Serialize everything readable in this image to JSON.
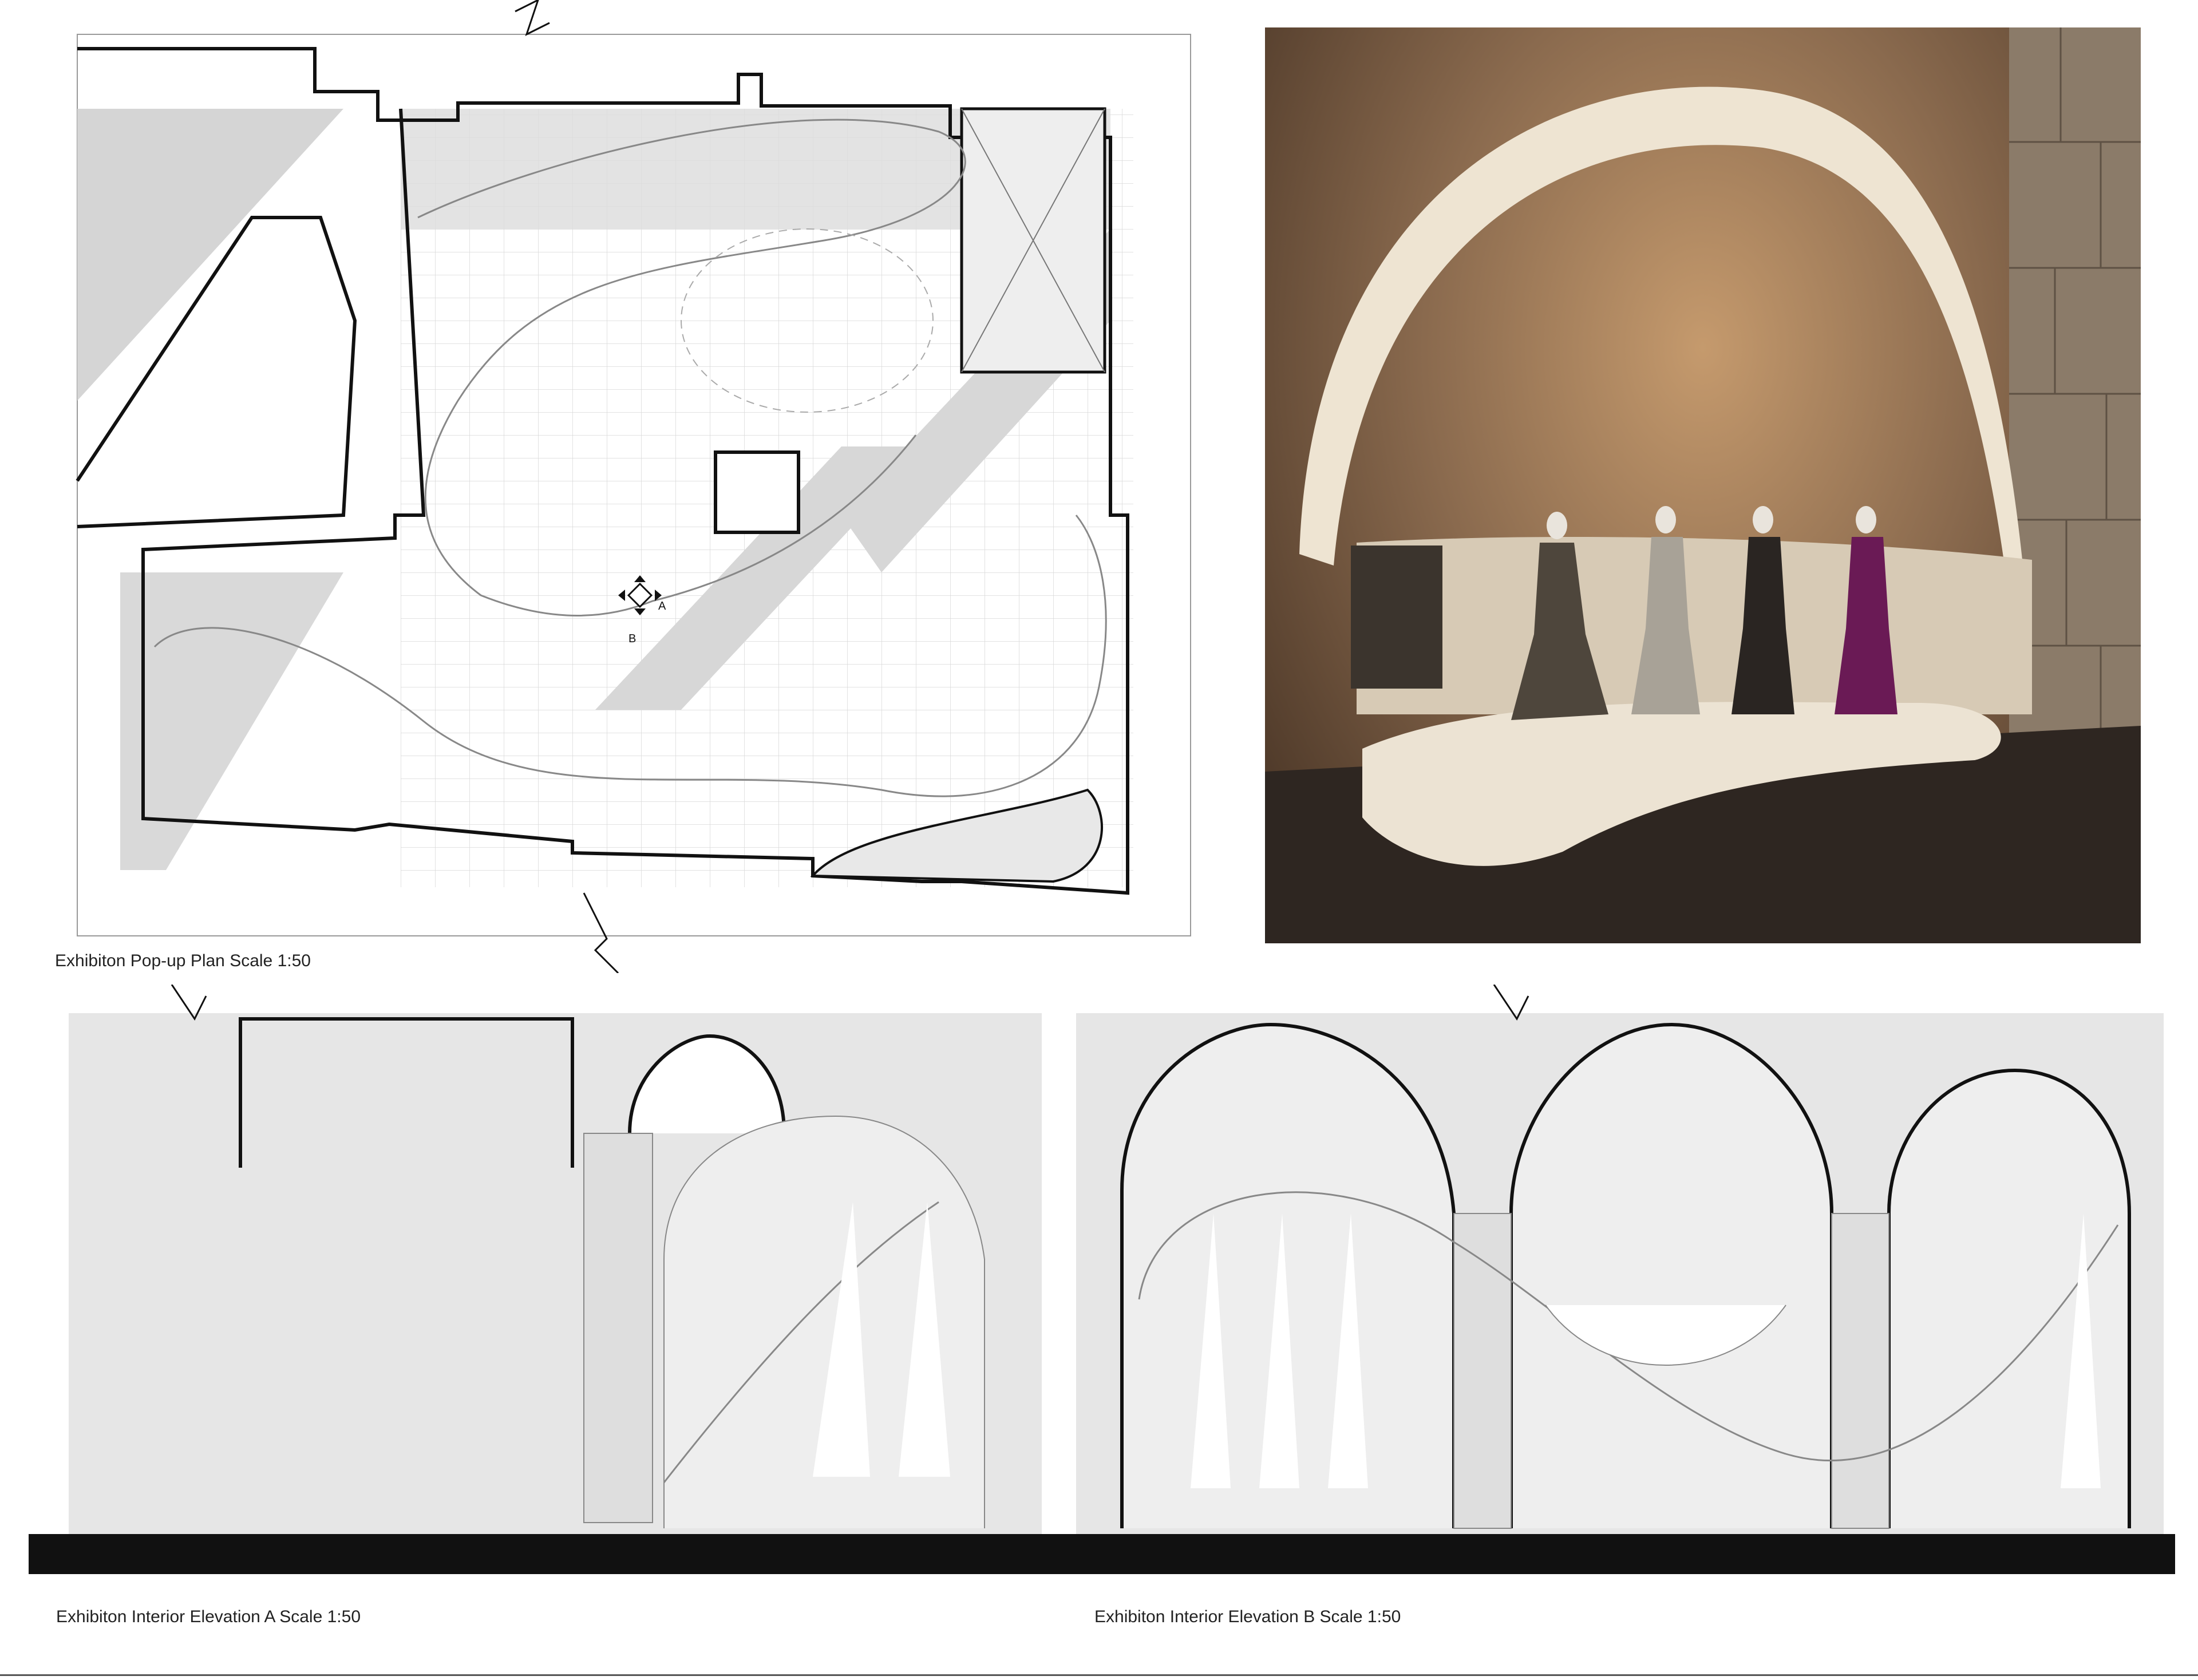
{
  "captions": {
    "plan": "Exhibiton Pop-up Plan Scale 1:50",
    "elevation_a": "Exhibiton Interior Elevation A Scale 1:50",
    "elevation_b": "Exhibiton Interior Elevation B Scale 1:50"
  },
  "plan_markers": {
    "section_a": "A",
    "section_b": "B"
  },
  "colors": {
    "hatch_gray": "#e6e6e6",
    "zone_gray": "#d7d7d7",
    "wall_black": "#111111",
    "render_wall_warm": "#8a6a4e",
    "render_arch_cream": "#eee4d2",
    "gown_purple": "#6a1a55"
  }
}
